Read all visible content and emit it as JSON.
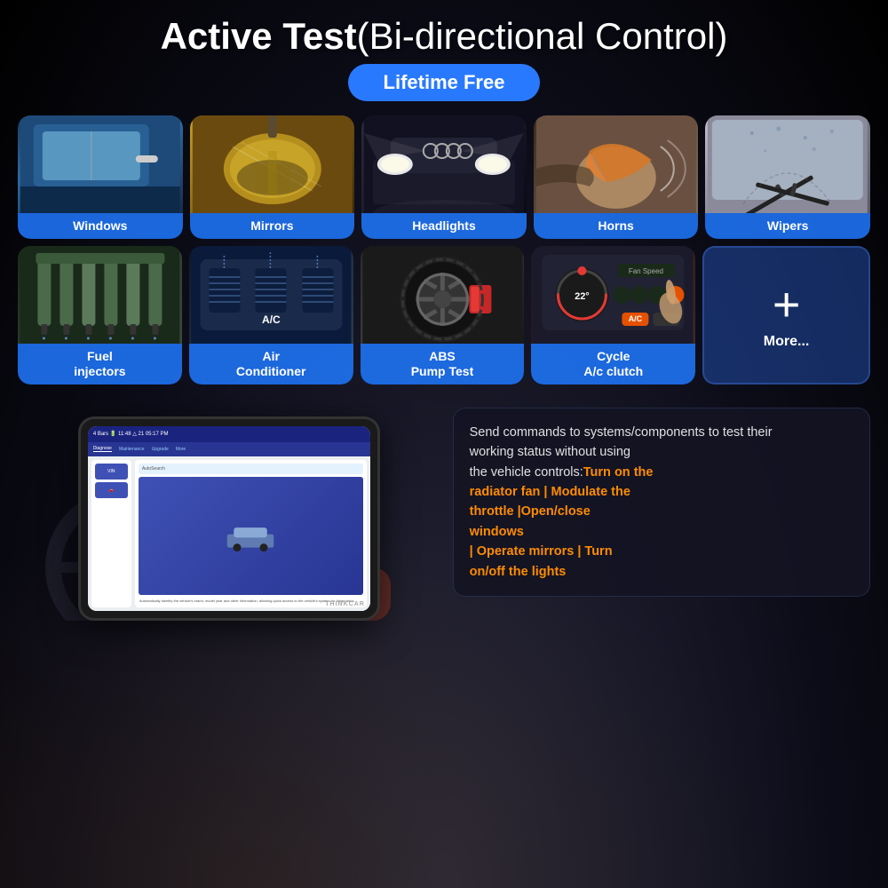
{
  "page": {
    "background": "#0d0d1a"
  },
  "header": {
    "title_bold": "Active Test",
    "title_normal": "(Bi-directional Control)",
    "badge_text": "Lifetime Free"
  },
  "row1_cards": [
    {
      "id": "windows",
      "label": "Windows",
      "img_type": "windows"
    },
    {
      "id": "mirrors",
      "label": "Mirrors",
      "img_type": "mirrors"
    },
    {
      "id": "headlights",
      "label": "Headlights",
      "img_type": "headlights"
    },
    {
      "id": "horns",
      "label": "Horns",
      "img_type": "horns"
    },
    {
      "id": "wipers",
      "label": "Wipers",
      "img_type": "wipers"
    }
  ],
  "row2_cards": [
    {
      "id": "fuel-injectors",
      "label": "Fuel\ninjectors",
      "img_type": "fuel"
    },
    {
      "id": "air-conditioner",
      "label": "Air\nConditioner",
      "img_type": "ac"
    },
    {
      "id": "abs-pump",
      "label": "ABS\nPump Test",
      "img_type": "abs"
    },
    {
      "id": "cycle-ac",
      "label": "Cycle\nA/c clutch",
      "img_type": "cycle"
    }
  ],
  "more_card": {
    "plus_symbol": "+",
    "label": "More..."
  },
  "info_box": {
    "normal_part1": "Send commands to systems/components to test their working status without using the vehicle controls:",
    "highlight_part": "Turn on the\nradiator fan | Modulate the\nthrottle |Open/close\nwindows\n| Operate mirrors | Turn\non/off the lights"
  },
  "tablet": {
    "brand": "THINKCAR",
    "nav_items": [
      "Diagnose",
      "Maintenance",
      "Upgrade",
      "More"
    ],
    "active_nav": "Diagnose",
    "search_label": "AutoSearch",
    "search_description": "Automatically identify the vehicle's brand, model year and other information, allowing quick access to the vehicle's system for diagnostics."
  }
}
